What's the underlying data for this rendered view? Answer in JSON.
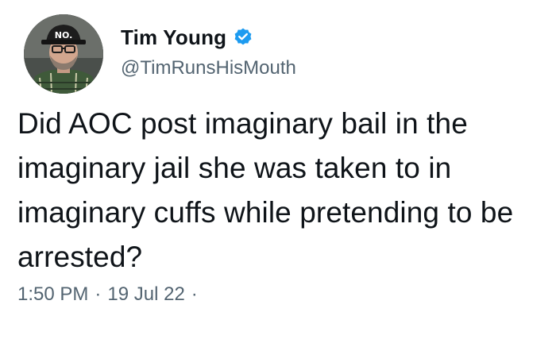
{
  "tweet": {
    "author": {
      "display_name": "Tim Young",
      "handle": "@TimRunsHisMouth",
      "verified": true,
      "avatar_icon": "avatar-photo",
      "hat_text": "NO."
    },
    "text": "Did AOC post imaginary bail in the imaginary jail she was taken to in imaginary cuffs while pretending to be arrested?",
    "time": "1:50 PM",
    "date": "19 Jul 22",
    "separator": "·",
    "colors": {
      "verified_badge": "#1d9bf0",
      "primary_text": "#0f1419",
      "secondary_text": "#536471"
    }
  }
}
